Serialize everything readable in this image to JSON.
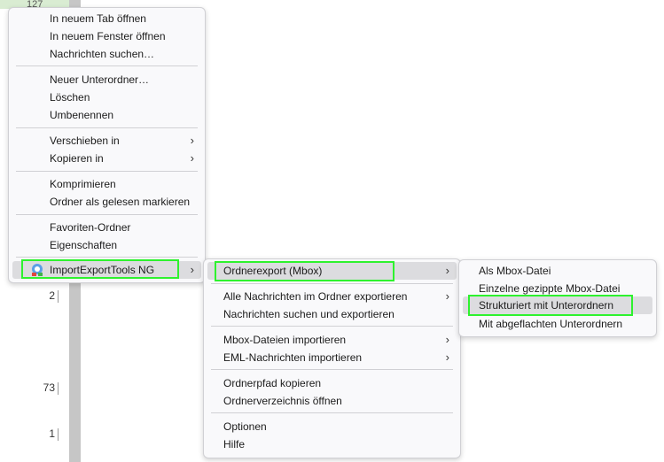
{
  "background": {
    "top_partial_count": "127",
    "folder_counts": [
      "2",
      "73",
      "1"
    ]
  },
  "context_menu": {
    "items": [
      {
        "label": "In neuem Tab öffnen"
      },
      {
        "label": "In neuem Fenster öffnen"
      },
      {
        "label": "Nachrichten suchen…"
      },
      {
        "label": "Neuer Unterordner…"
      },
      {
        "label": "Löschen"
      },
      {
        "label": "Umbenennen"
      },
      {
        "label": "Verschieben in",
        "submenu_arrow": "›"
      },
      {
        "label": "Kopieren in",
        "submenu_arrow": "›"
      },
      {
        "label": "Komprimieren"
      },
      {
        "label": "Ordner als gelesen markieren"
      },
      {
        "label": "Favoriten-Ordner"
      },
      {
        "label": "Eigenschaften"
      },
      {
        "label": "ImportExportTools NG",
        "submenu_arrow": "›",
        "icon": "importexport-addon-icon"
      }
    ]
  },
  "importexport_menu": {
    "items": [
      {
        "label": "Ordnerexport (Mbox)",
        "submenu_arrow": "›"
      },
      {
        "label": "Alle Nachrichten im Ordner exportieren",
        "submenu_arrow": "›"
      },
      {
        "label": "Nachrichten suchen und exportieren"
      },
      {
        "label": "Mbox-Dateien importieren",
        "submenu_arrow": "›"
      },
      {
        "label": "EML-Nachrichten importieren",
        "submenu_arrow": "›"
      },
      {
        "label": "Ordnerpfad kopieren"
      },
      {
        "label": "Ordnerverzeichnis öffnen"
      },
      {
        "label": "Optionen"
      },
      {
        "label": "Hilfe"
      }
    ]
  },
  "mbox_export_menu": {
    "items": [
      {
        "label": "Als Mbox-Datei"
      },
      {
        "label": "Einzelne gezippte Mbox-Datei"
      },
      {
        "label": "Strukturiert mit Unterordnern"
      },
      {
        "label": "Mit abgeflachten Unterordnern"
      }
    ]
  },
  "colors": {
    "highlight_outline": "#2ef22e",
    "menu_background": "#f9f9fb",
    "hover_background": "#dcdcdf"
  }
}
